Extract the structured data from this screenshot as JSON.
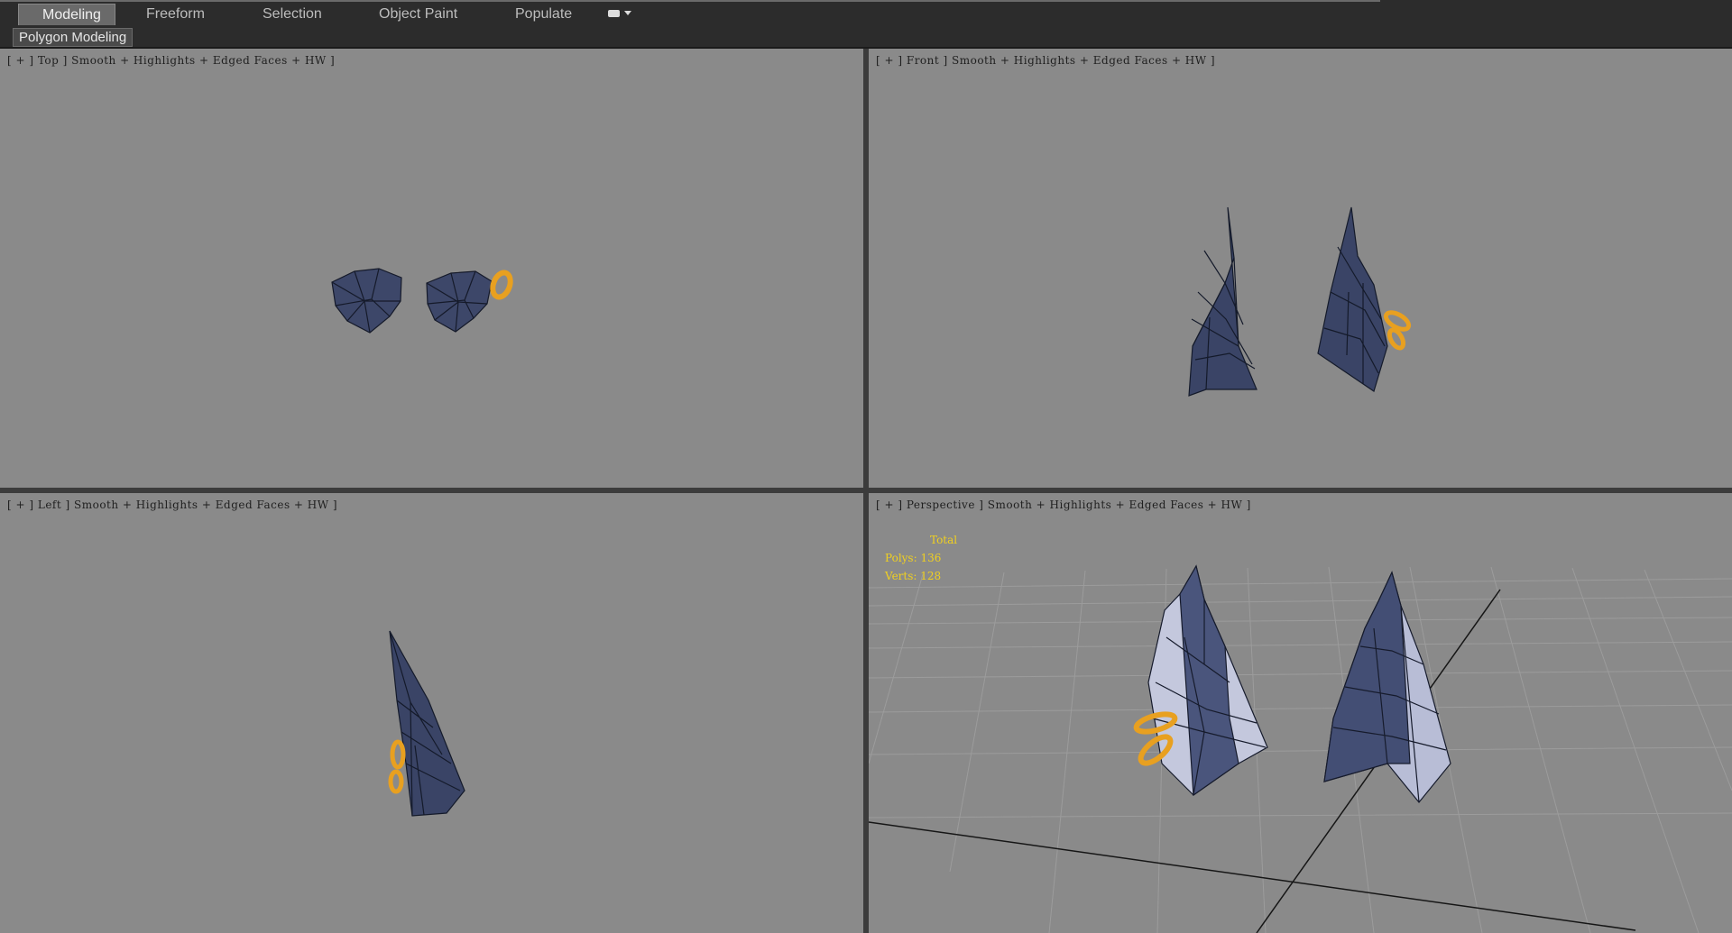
{
  "ribbon": {
    "tabs": [
      {
        "label": "Modeling",
        "active": true
      },
      {
        "label": "Freeform",
        "active": false
      },
      {
        "label": "Selection",
        "active": false
      },
      {
        "label": "Object Paint",
        "active": false
      },
      {
        "label": "Populate",
        "active": false
      }
    ],
    "panel_label": "Polygon Modeling"
  },
  "viewports": {
    "top": {
      "label": "[ + ] Top ] Smooth + Highlights + Edged Faces + HW ]"
    },
    "front": {
      "label": "[ + ] Front ] Smooth + Highlights + Edged Faces + HW ]"
    },
    "left": {
      "label": "[ + ] Left ] Smooth + Highlights + Edged Faces + HW ]"
    },
    "perspective": {
      "label": "[ + ] Perspective ] Smooth + Highlights + Edged Faces + HW ]",
      "stats": {
        "total": "Total",
        "polys": "Polys: 136",
        "verts": "Verts: 128"
      }
    }
  },
  "colors": {
    "viewport_bg": "#8a8a8a",
    "mesh_dark": "#3c4668",
    "mesh_light": "#c8cce0",
    "ring": "#e8a020",
    "stats_text": "#f0d020"
  }
}
